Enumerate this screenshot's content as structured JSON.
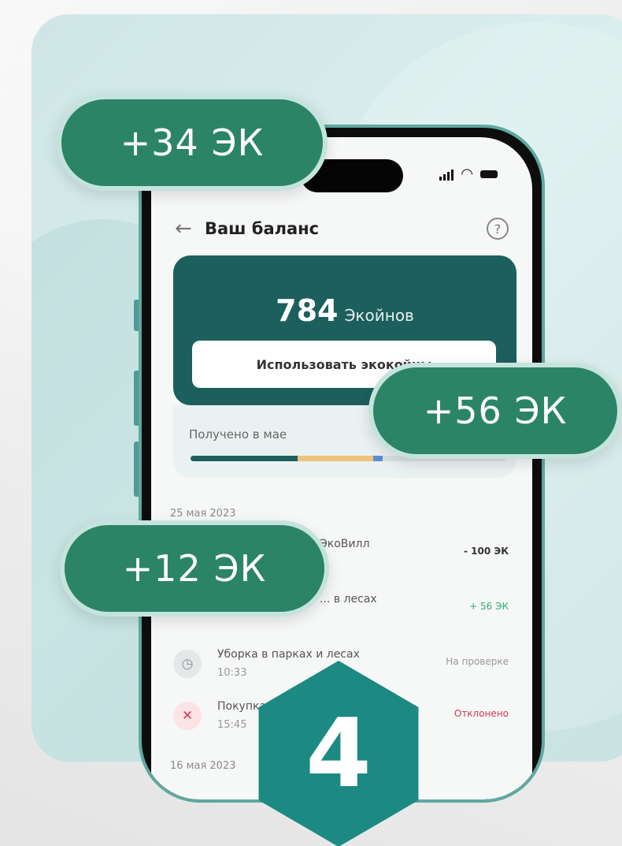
{
  "status_bar": {
    "signal_icon": "signal-icon",
    "wifi_icon": "wifi-icon",
    "battery_icon": "battery-icon"
  },
  "header": {
    "title": "Ваш баланс",
    "back_icon": "arrow-left-icon",
    "help_icon": "question-icon",
    "help_glyph": "?"
  },
  "balance": {
    "amount": "784",
    "unit": "Экойнов",
    "use_button_label": "Использовать экокойны"
  },
  "received": {
    "label": "Получено в мае"
  },
  "transactions": {
    "date_1": "25 мая 2023",
    "date_2": "16 мая 2023",
    "items": [
      {
        "title": "ЭкоВилл",
        "time": "",
        "amount": "- 100 ЭК"
      },
      {
        "title": "... в лесах",
        "time": "",
        "amount": "+ 56 ЭК"
      },
      {
        "title": "Уборка в парках и лесах",
        "time": "10:33",
        "amount": "На проверке"
      },
      {
        "title": "Покупка",
        "time": "15:45",
        "amount": "Отклонено"
      }
    ]
  },
  "pills": {
    "p1": "+34 ЭК",
    "p2": "+56 ЭК",
    "p3": "+12 ЭК"
  },
  "step_badge": "4",
  "colors": {
    "accent": "#2c8466",
    "card": "#1c5f5c",
    "hex": "#1d8983"
  }
}
